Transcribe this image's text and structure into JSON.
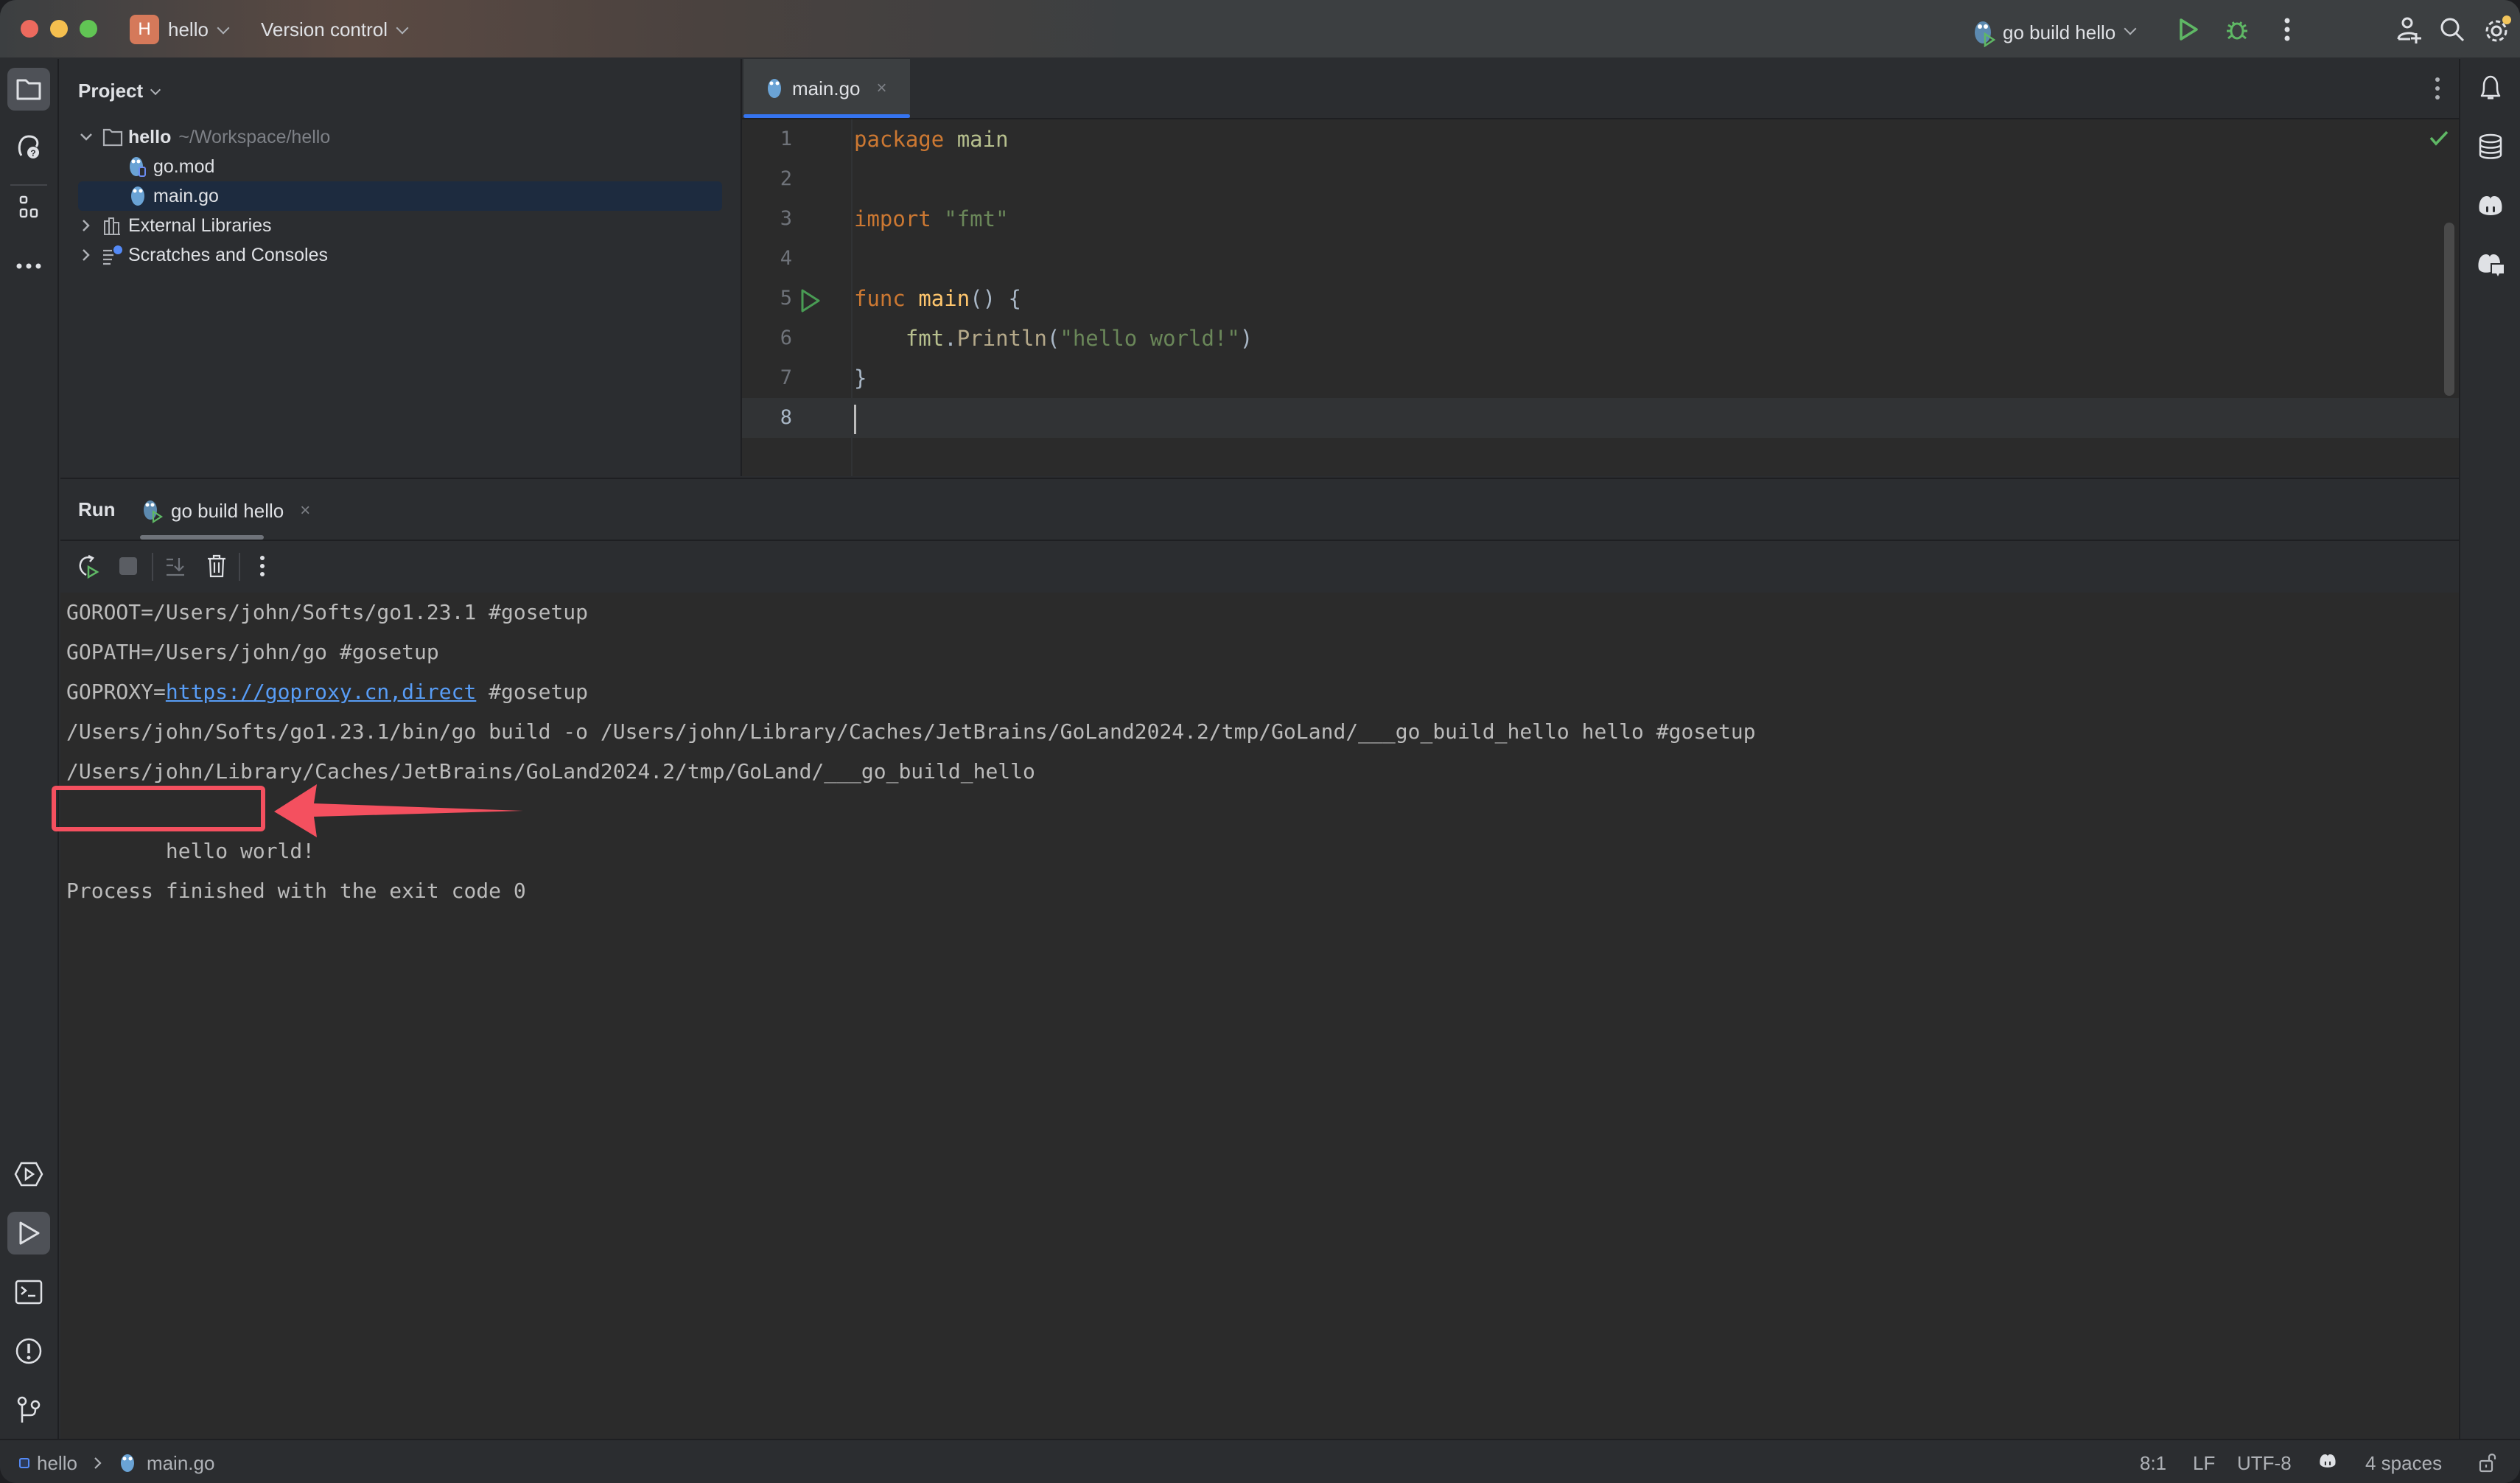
{
  "window": {
    "project_badge": "H",
    "project_name": "hello",
    "vcs_label": "Version control",
    "run_config": "go build hello"
  },
  "colors": {
    "accent": "#3574f0",
    "run_green": "#5fb865",
    "annotation_red": "#f4505f",
    "link": "#589df6"
  },
  "project_panel": {
    "title": "Project",
    "tree": [
      {
        "label": "hello",
        "hint": "~/Workspace/hello",
        "icon": "folder-icon",
        "expanded": true
      },
      {
        "label": "go.mod",
        "icon": "go-mod-icon"
      },
      {
        "label": "main.go",
        "icon": "go-file-icon",
        "selected": true
      },
      {
        "label": "External Libraries",
        "icon": "library-icon",
        "expanded": false
      },
      {
        "label": "Scratches and Consoles",
        "icon": "scratches-icon",
        "expanded": false
      }
    ]
  },
  "editor": {
    "tab": {
      "label": "main.go",
      "close": "×"
    },
    "lines": [
      {
        "n": "1"
      },
      {
        "n": "2"
      },
      {
        "n": "3"
      },
      {
        "n": "4"
      },
      {
        "n": "5"
      },
      {
        "n": "6"
      },
      {
        "n": "7"
      },
      {
        "n": "8"
      }
    ],
    "code": {
      "l1_kw": "package",
      "l1_name": "main",
      "l3_kw": "import",
      "l3_str": "\"fmt\"",
      "l5_kw": "func",
      "l5_fn": "main",
      "l5_rest": "() {",
      "l6_pkg": "fmt",
      "l6_dot": ".",
      "l6_mth": "Println",
      "l6_open": "(",
      "l6_str": "\"hello world!\"",
      "l6_close": ")",
      "l7": "}"
    },
    "caret_line": 8
  },
  "run_panel": {
    "title": "Run",
    "tab_label": "go build hello",
    "tab_close": "×",
    "console": {
      "goroot": "GOROOT=/Users/john/Softs/go1.23.1 #gosetup",
      "gopath": "GOPATH=/Users/john/go #gosetup",
      "goproxy_prefix": "GOPROXY=",
      "goproxy_link": "https://goproxy.cn,direct",
      "goproxy_suffix": " #gosetup",
      "build_cmd": "/Users/john/Softs/go1.23.1/bin/go build -o /Users/john/Library/Caches/JetBrains/GoLand2024.2/tmp/GoLand/___go_build_hello hello #gosetup",
      "exec_path": "/Users/john/Library/Caches/JetBrains/GoLand2024.2/tmp/GoLand/___go_build_hello",
      "output": "hello world!",
      "finished": "Process finished with the exit code 0"
    }
  },
  "status_bar": {
    "breadcrumb_project": "hello",
    "breadcrumb_file": "main.go",
    "position": "8:1",
    "line_sep": "LF",
    "encoding": "UTF-8",
    "indent": "4 spaces"
  }
}
